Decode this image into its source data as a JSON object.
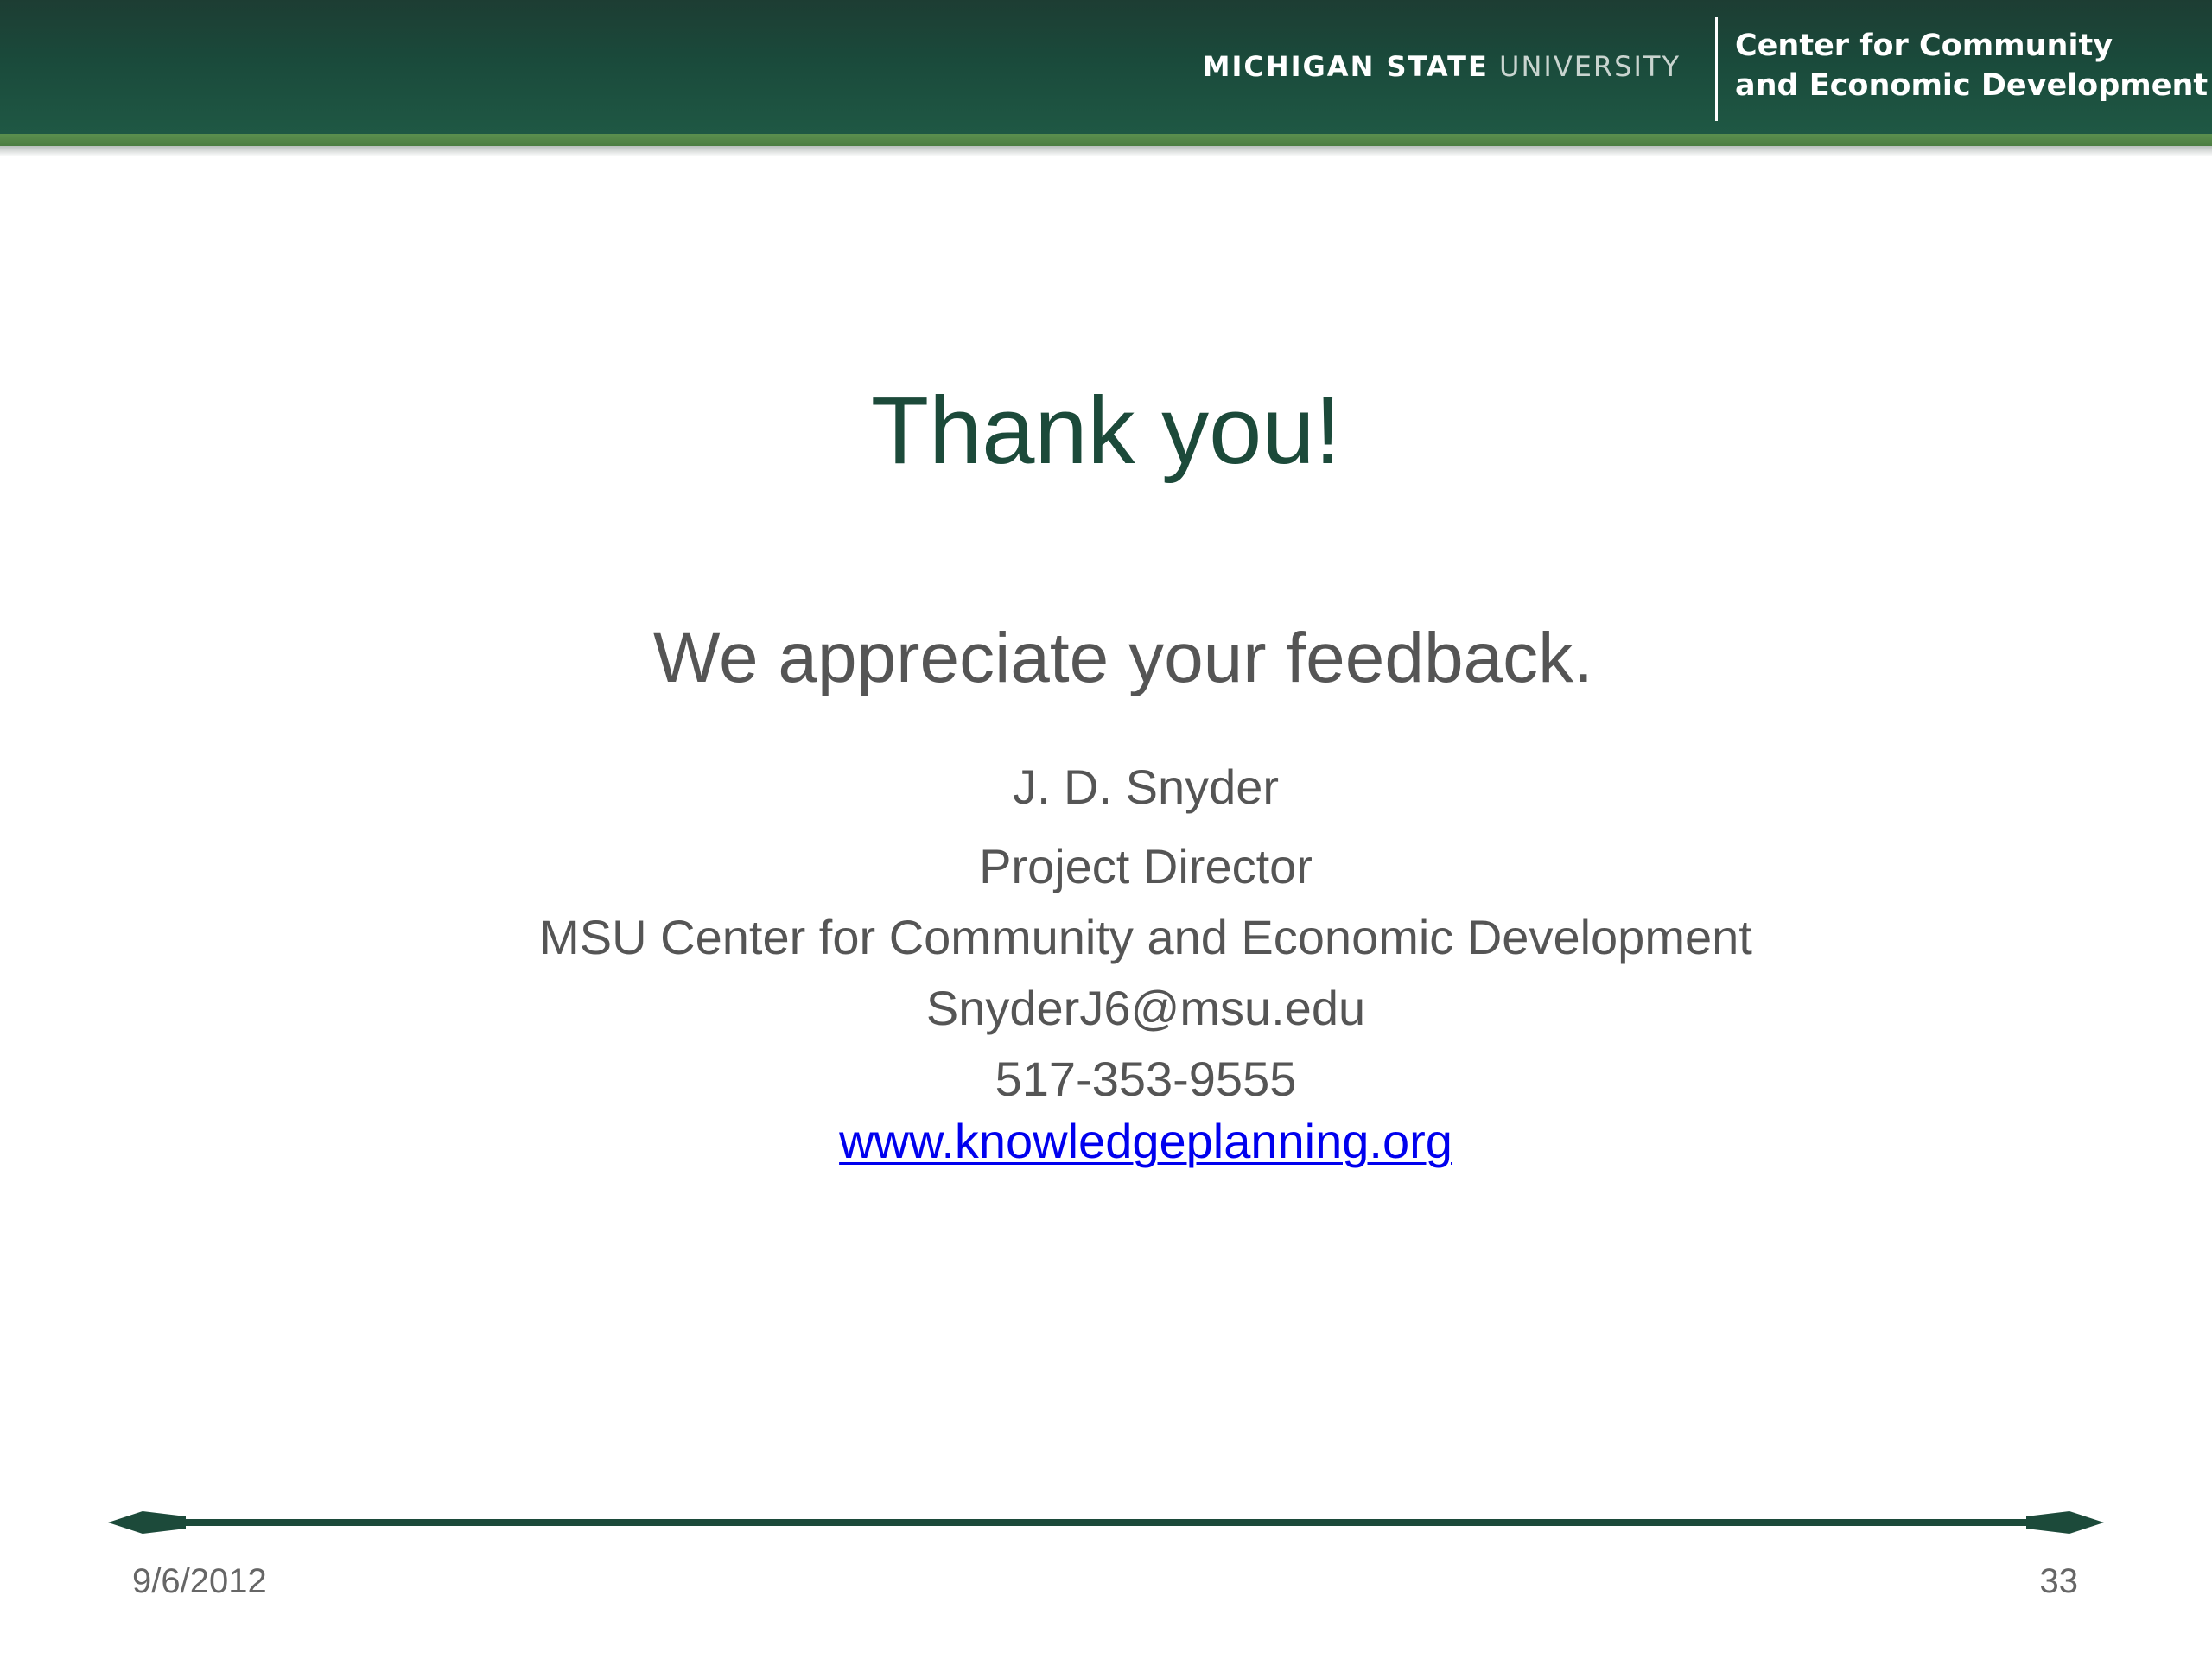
{
  "header": {
    "university_bold": "MICHIGAN STATE",
    "university_light": "UNIVERSITY",
    "center_line1": "Center for Community",
    "center_line2": "and Economic Development"
  },
  "slide": {
    "title": "Thank you!",
    "subtitle": "We appreciate your feedback.",
    "contact": {
      "name": "J. D. Snyder",
      "role": "Project Director",
      "organization": "MSU Center for Community and Economic Development",
      "email": "SnyderJ6@msu.edu",
      "phone": "517-353-9555",
      "website": "www.knowledgeplanning.org"
    }
  },
  "footer": {
    "date": "9/6/2012",
    "page_number": "33"
  },
  "colors": {
    "header_green": "#1a4a3b",
    "accent_green": "#5b8f4e",
    "title_green": "#1c4a3a",
    "body_gray": "#555555",
    "link_blue": "#0000ee"
  }
}
